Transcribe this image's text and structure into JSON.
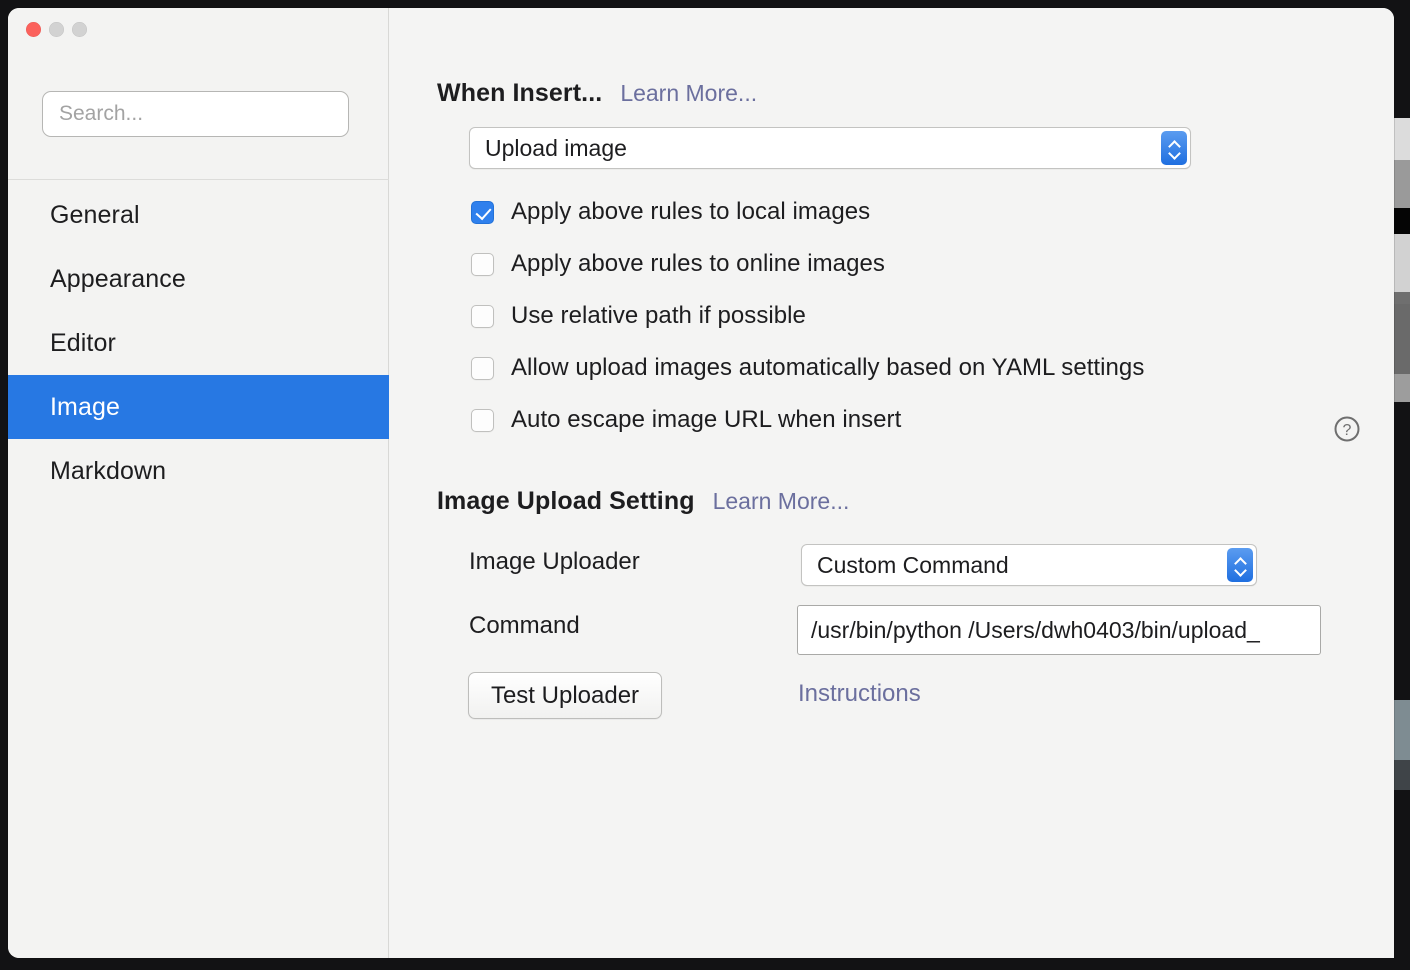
{
  "window": {
    "traffic_lights": {
      "close_label": "Close",
      "minimize_label": "Minimize",
      "zoom_label": "Zoom"
    }
  },
  "sidebar": {
    "search": {
      "value": "",
      "placeholder": "Search..."
    },
    "items": [
      {
        "label": "General",
        "selected": false
      },
      {
        "label": "Appearance",
        "selected": false
      },
      {
        "label": "Editor",
        "selected": false
      },
      {
        "label": "Image",
        "selected": true
      },
      {
        "label": "Markdown",
        "selected": false
      }
    ]
  },
  "main": {
    "when_insert": {
      "title": "When Insert...",
      "learn_more": "Learn More...",
      "action_select": {
        "value": "Upload image",
        "options": [
          "Upload image"
        ]
      },
      "checkboxes": [
        {
          "label": "Apply above rules to local images",
          "checked": true
        },
        {
          "label": "Apply above rules to online images",
          "checked": false
        },
        {
          "label": "Use relative path if possible",
          "checked": false
        },
        {
          "label": "Allow upload images automatically based on YAML settings",
          "checked": false
        },
        {
          "label": "Auto escape image URL when insert",
          "checked": false
        }
      ],
      "help_icon": "question-mark-circle-icon"
    },
    "upload_setting": {
      "title": "Image Upload Setting",
      "learn_more": "Learn More...",
      "uploader_label": "Image Uploader",
      "uploader_select": {
        "value": "Custom Command",
        "options": [
          "Custom Command"
        ]
      },
      "command_label": "Command",
      "command_value": "/usr/bin/python /Users/dwh0403/bin/upload_",
      "test_button": "Test Uploader",
      "instructions_link": "Instructions"
    }
  },
  "colors": {
    "accent": "#2778e3",
    "stepper_blue": "#2f80ed",
    "link": "#6b6f9e",
    "close_red": "#fb615c",
    "window_bg": "#f4f4f3"
  }
}
